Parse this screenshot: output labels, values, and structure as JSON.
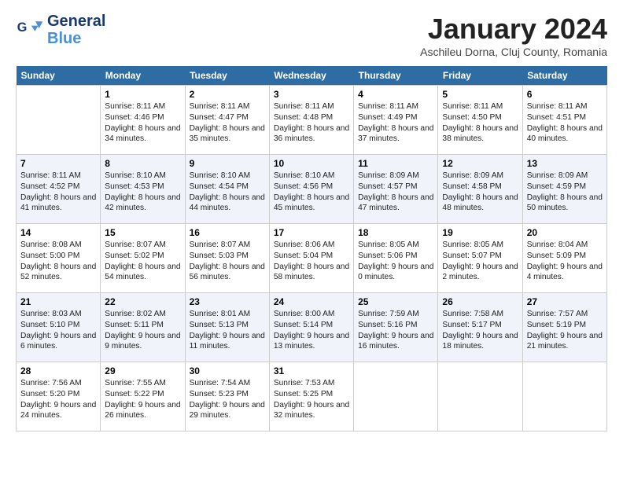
{
  "header": {
    "logo_line1": "General",
    "logo_line2": "Blue",
    "month": "January 2024",
    "location": "Aschileu Dorna, Cluj County, Romania"
  },
  "weekdays": [
    "Sunday",
    "Monday",
    "Tuesday",
    "Wednesday",
    "Thursday",
    "Friday",
    "Saturday"
  ],
  "weeks": [
    [
      {
        "date": "",
        "sunrise": "",
        "sunset": "",
        "daylight": ""
      },
      {
        "date": "1",
        "sunrise": "Sunrise: 8:11 AM",
        "sunset": "Sunset: 4:46 PM",
        "daylight": "Daylight: 8 hours and 34 minutes."
      },
      {
        "date": "2",
        "sunrise": "Sunrise: 8:11 AM",
        "sunset": "Sunset: 4:47 PM",
        "daylight": "Daylight: 8 hours and 35 minutes."
      },
      {
        "date": "3",
        "sunrise": "Sunrise: 8:11 AM",
        "sunset": "Sunset: 4:48 PM",
        "daylight": "Daylight: 8 hours and 36 minutes."
      },
      {
        "date": "4",
        "sunrise": "Sunrise: 8:11 AM",
        "sunset": "Sunset: 4:49 PM",
        "daylight": "Daylight: 8 hours and 37 minutes."
      },
      {
        "date": "5",
        "sunrise": "Sunrise: 8:11 AM",
        "sunset": "Sunset: 4:50 PM",
        "daylight": "Daylight: 8 hours and 38 minutes."
      },
      {
        "date": "6",
        "sunrise": "Sunrise: 8:11 AM",
        "sunset": "Sunset: 4:51 PM",
        "daylight": "Daylight: 8 hours and 40 minutes."
      }
    ],
    [
      {
        "date": "7",
        "sunrise": "Sunrise: 8:11 AM",
        "sunset": "Sunset: 4:52 PM",
        "daylight": "Daylight: 8 hours and 41 minutes."
      },
      {
        "date": "8",
        "sunrise": "Sunrise: 8:10 AM",
        "sunset": "Sunset: 4:53 PM",
        "daylight": "Daylight: 8 hours and 42 minutes."
      },
      {
        "date": "9",
        "sunrise": "Sunrise: 8:10 AM",
        "sunset": "Sunset: 4:54 PM",
        "daylight": "Daylight: 8 hours and 44 minutes."
      },
      {
        "date": "10",
        "sunrise": "Sunrise: 8:10 AM",
        "sunset": "Sunset: 4:56 PM",
        "daylight": "Daylight: 8 hours and 45 minutes."
      },
      {
        "date": "11",
        "sunrise": "Sunrise: 8:09 AM",
        "sunset": "Sunset: 4:57 PM",
        "daylight": "Daylight: 8 hours and 47 minutes."
      },
      {
        "date": "12",
        "sunrise": "Sunrise: 8:09 AM",
        "sunset": "Sunset: 4:58 PM",
        "daylight": "Daylight: 8 hours and 48 minutes."
      },
      {
        "date": "13",
        "sunrise": "Sunrise: 8:09 AM",
        "sunset": "Sunset: 4:59 PM",
        "daylight": "Daylight: 8 hours and 50 minutes."
      }
    ],
    [
      {
        "date": "14",
        "sunrise": "Sunrise: 8:08 AM",
        "sunset": "Sunset: 5:00 PM",
        "daylight": "Daylight: 8 hours and 52 minutes."
      },
      {
        "date": "15",
        "sunrise": "Sunrise: 8:07 AM",
        "sunset": "Sunset: 5:02 PM",
        "daylight": "Daylight: 8 hours and 54 minutes."
      },
      {
        "date": "16",
        "sunrise": "Sunrise: 8:07 AM",
        "sunset": "Sunset: 5:03 PM",
        "daylight": "Daylight: 8 hours and 56 minutes."
      },
      {
        "date": "17",
        "sunrise": "Sunrise: 8:06 AM",
        "sunset": "Sunset: 5:04 PM",
        "daylight": "Daylight: 8 hours and 58 minutes."
      },
      {
        "date": "18",
        "sunrise": "Sunrise: 8:05 AM",
        "sunset": "Sunset: 5:06 PM",
        "daylight": "Daylight: 9 hours and 0 minutes."
      },
      {
        "date": "19",
        "sunrise": "Sunrise: 8:05 AM",
        "sunset": "Sunset: 5:07 PM",
        "daylight": "Daylight: 9 hours and 2 minutes."
      },
      {
        "date": "20",
        "sunrise": "Sunrise: 8:04 AM",
        "sunset": "Sunset: 5:09 PM",
        "daylight": "Daylight: 9 hours and 4 minutes."
      }
    ],
    [
      {
        "date": "21",
        "sunrise": "Sunrise: 8:03 AM",
        "sunset": "Sunset: 5:10 PM",
        "daylight": "Daylight: 9 hours and 6 minutes."
      },
      {
        "date": "22",
        "sunrise": "Sunrise: 8:02 AM",
        "sunset": "Sunset: 5:11 PM",
        "daylight": "Daylight: 9 hours and 9 minutes."
      },
      {
        "date": "23",
        "sunrise": "Sunrise: 8:01 AM",
        "sunset": "Sunset: 5:13 PM",
        "daylight": "Daylight: 9 hours and 11 minutes."
      },
      {
        "date": "24",
        "sunrise": "Sunrise: 8:00 AM",
        "sunset": "Sunset: 5:14 PM",
        "daylight": "Daylight: 9 hours and 13 minutes."
      },
      {
        "date": "25",
        "sunrise": "Sunrise: 7:59 AM",
        "sunset": "Sunset: 5:16 PM",
        "daylight": "Daylight: 9 hours and 16 minutes."
      },
      {
        "date": "26",
        "sunrise": "Sunrise: 7:58 AM",
        "sunset": "Sunset: 5:17 PM",
        "daylight": "Daylight: 9 hours and 18 minutes."
      },
      {
        "date": "27",
        "sunrise": "Sunrise: 7:57 AM",
        "sunset": "Sunset: 5:19 PM",
        "daylight": "Daylight: 9 hours and 21 minutes."
      }
    ],
    [
      {
        "date": "28",
        "sunrise": "Sunrise: 7:56 AM",
        "sunset": "Sunset: 5:20 PM",
        "daylight": "Daylight: 9 hours and 24 minutes."
      },
      {
        "date": "29",
        "sunrise": "Sunrise: 7:55 AM",
        "sunset": "Sunset: 5:22 PM",
        "daylight": "Daylight: 9 hours and 26 minutes."
      },
      {
        "date": "30",
        "sunrise": "Sunrise: 7:54 AM",
        "sunset": "Sunset: 5:23 PM",
        "daylight": "Daylight: 9 hours and 29 minutes."
      },
      {
        "date": "31",
        "sunrise": "Sunrise: 7:53 AM",
        "sunset": "Sunset: 5:25 PM",
        "daylight": "Daylight: 9 hours and 32 minutes."
      },
      {
        "date": "",
        "sunrise": "",
        "sunset": "",
        "daylight": ""
      },
      {
        "date": "",
        "sunrise": "",
        "sunset": "",
        "daylight": ""
      },
      {
        "date": "",
        "sunrise": "",
        "sunset": "",
        "daylight": ""
      }
    ]
  ]
}
